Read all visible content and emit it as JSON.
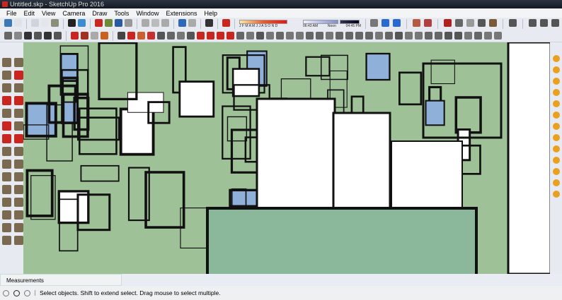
{
  "window": {
    "title": "Untitled.skp - SketchUp Pro 2016"
  },
  "menu": [
    "File",
    "Edit",
    "View",
    "Camera",
    "Draw",
    "Tools",
    "Window",
    "Extensions",
    "Help"
  ],
  "shadows": {
    "months": "J F M A M J J A S O N D",
    "time_start": "06:43 AM",
    "time_mid": "Noon",
    "time_end": "04:45 PM"
  },
  "toolbar1_colors": [
    "#3c78b4",
    "#dfe3e8",
    "#cfd5dc",
    "#e4e7ea",
    "#8a8f78",
    "#222222",
    "#3c8cd2",
    "#c8261e",
    "#6d8a3a",
    "#2a5aa0",
    "#999999",
    "#aaaaaa",
    "#bbbbbb",
    "#aaaaaa",
    "#2f6ab8",
    "#aaaaaa",
    "#333333",
    "#c8261e"
  ],
  "toolbar1b_colors": [
    "#777777",
    "#2a6ad0",
    "#2a6ad0",
    "#b35b45",
    "#b04040",
    "#b02020",
    "#666666",
    "#999999",
    "#555555",
    "#7a5a3a",
    "#555555",
    "#555555",
    "#555555",
    "#555555",
    "#2a6ad0",
    "#2a6ad0"
  ],
  "toolbar2_colors": [
    "#666666",
    "#888888",
    "#333333",
    "#555555",
    "#333333",
    "#555555",
    "#c8261e",
    "#a03020",
    "#aaaaaa",
    "#c86020",
    "#444444",
    "#c8261e",
    "#c86030",
    "#c83030",
    "#555555",
    "#666666",
    "#777777",
    "#555555",
    "#c8261e",
    "#c8261e",
    "#c8261e",
    "#c8261e",
    "#666666",
    "#777777",
    "#555555",
    "#777777",
    "#666666",
    "#777777",
    "#777777",
    "#666666",
    "#666666",
    "#777777",
    "#666666",
    "#666666",
    "#666666",
    "#666666",
    "#777777",
    "#666666",
    "#555555",
    "#777777",
    "#777777",
    "#666666",
    "#666666",
    "#555555",
    "#555555",
    "#777777",
    "#666666",
    "#777777",
    "#777777"
  ],
  "left_tools": [
    "select",
    "paint-bucket",
    "eraser",
    "line",
    "rectangle",
    "circle",
    "arc",
    "freehand",
    "push-pull",
    "move",
    "rotate",
    "scale",
    "follow-me",
    "offset",
    "tape-measure",
    "protractor",
    "text",
    "dimension",
    "axes",
    "3d-text",
    "orbit",
    "pan",
    "zoom",
    "zoom-window",
    "zoom-extents",
    "previous",
    "walk",
    "look-around",
    "position-camera",
    "section-plane"
  ],
  "right_tools": 13,
  "measurements": {
    "label": "Measurements"
  },
  "status": {
    "message": "Select objects. Shift to extend select. Drag mouse to select multiple."
  }
}
